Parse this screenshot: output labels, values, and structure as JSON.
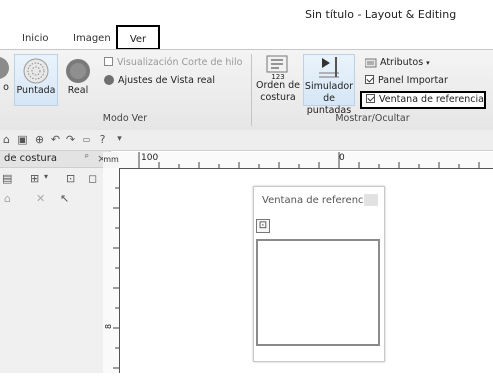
{
  "window": {
    "title": "Sin título - Layout & Editing"
  },
  "tabs": [
    {
      "label": "Inicio"
    },
    {
      "label": "Imagen"
    },
    {
      "label": "Ver"
    }
  ],
  "ribbon": {
    "modo_ver": {
      "label": "Modo Ver",
      "puntada": "Puntada",
      "real": "Real",
      "partial_label": "o",
      "visualizacion_corte": "Visualización Corte de hilo",
      "ajustes_vista_real": "Ajustes de Vista real"
    },
    "mostrar_ocultar": {
      "label": "Mostrar/Ocultar",
      "orden_line1": "Orden de",
      "orden_line2": "costura",
      "orden_icon_text": "123",
      "simulador_line1": "Simulador",
      "simulador_line2": "de puntadas",
      "atributos": "Atributos",
      "panel_importar": "Panel Importar",
      "ventana_referencia": "Ventana de referencia"
    }
  },
  "left_panel": {
    "title": "de costura",
    "pin": "ᵖ",
    "close": "×"
  },
  "ruler": {
    "unit": "mm",
    "h_label_1": "100",
    "h_label_2": "0",
    "v_label": "8"
  },
  "reference_window": {
    "title": "Ventana de referencia"
  }
}
